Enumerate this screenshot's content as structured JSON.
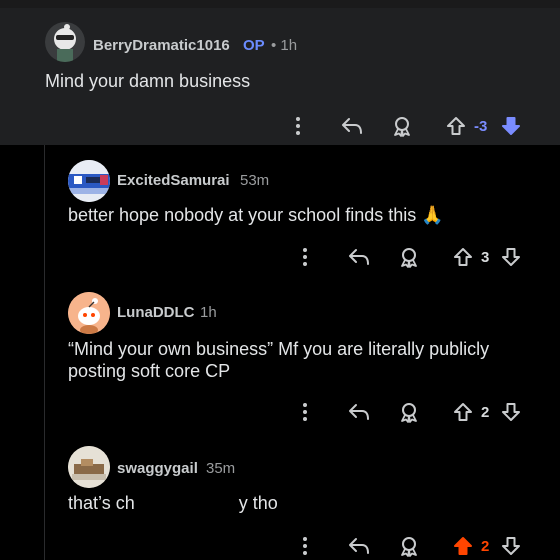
{
  "parent": {
    "username": "BerryDramatic1016",
    "op_label": "OP",
    "time": "• 1h",
    "body": "Mind your damn business",
    "vote_count": "-3",
    "vote_color": "#7a8cff",
    "downvote_active": true
  },
  "replies": [
    {
      "username": "ExcitedSamurai",
      "time": "53m",
      "body": "better hope nobody at your school finds this 🙏",
      "vote_count": "3",
      "upvote_active": false
    },
    {
      "username": "LunaDDLC",
      "time": "1h",
      "body": "“Mind your own business” Mf you are literally publicly posting soft core CP",
      "vote_count": "2",
      "upvote_active": false
    },
    {
      "username": "swaggygail",
      "time": "35m",
      "body_start": "that’s ch",
      "body_end": "hy tho",
      "vote_count": "2",
      "upvote_active": true,
      "upvote_color": "#ff4500"
    }
  ],
  "icons": {
    "more": "more-vertical-icon",
    "reply": "reply-arrow-icon",
    "award": "award-icon",
    "upvote": "upvote-arrow-icon",
    "downvote": "downvote-arrow-icon"
  },
  "colors": {
    "background": "#000000",
    "parent_card": "#1f2022",
    "text": "#e3e5e7",
    "muted": "#9a9c9e",
    "op": "#6b8cff",
    "orangered": "#ff4500",
    "periwinkle": "#7a8cff"
  }
}
